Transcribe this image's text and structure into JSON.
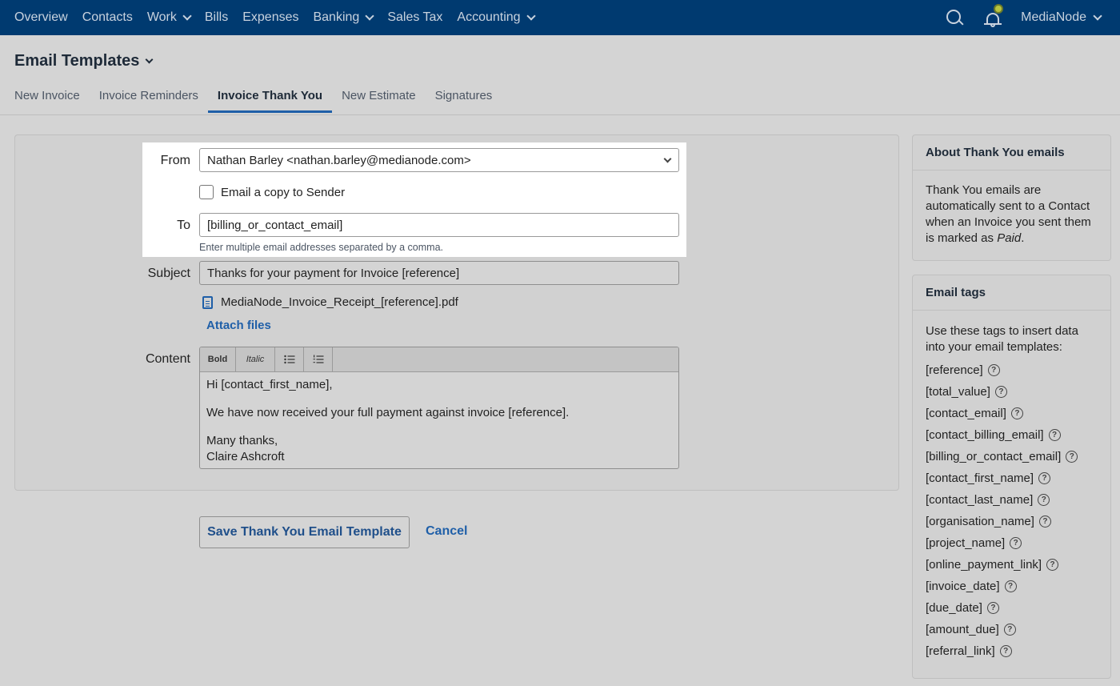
{
  "nav": {
    "items": [
      {
        "label": "Overview",
        "dropdown": false
      },
      {
        "label": "Contacts",
        "dropdown": false
      },
      {
        "label": "Work",
        "dropdown": true
      },
      {
        "label": "Bills",
        "dropdown": false
      },
      {
        "label": "Expenses",
        "dropdown": false
      },
      {
        "label": "Banking",
        "dropdown": true
      },
      {
        "label": "Sales Tax",
        "dropdown": false
      },
      {
        "label": "Accounting",
        "dropdown": true
      }
    ],
    "account": "MediaNode"
  },
  "page": {
    "title": "Email Templates",
    "tabs": [
      "New Invoice",
      "Invoice Reminders",
      "Invoice Thank You",
      "New Estimate",
      "Signatures"
    ],
    "active_tab": "Invoice Thank You"
  },
  "form": {
    "from_label": "From",
    "from_value": "Nathan Barley <nathan.barley@medianode.com>",
    "copy_label": "Email a copy to Sender",
    "to_label": "To",
    "to_value": "[billing_or_contact_email]",
    "to_hint": "Enter multiple email addresses separated by a comma.",
    "subject_label": "Subject",
    "subject_value": "Thanks for your payment for Invoice [reference]",
    "attachment": "MediaNode_Invoice_Receipt_[reference].pdf",
    "attach_files": "Attach files",
    "content_label": "Content",
    "toolbar": {
      "bold": "Bold",
      "italic": "Italic"
    },
    "content": {
      "line1": "Hi [contact_first_name],",
      "line2": "We have now received your full payment against invoice [reference].",
      "line3": "Many thanks,",
      "line4": "Claire Ashcroft"
    },
    "save_label": "Save Thank You Email Template",
    "cancel_label": "Cancel"
  },
  "about": {
    "title": "About Thank You emails",
    "text": "Thank You emails are automatically sent to a Contact when an Invoice you sent them is marked as ",
    "emphasis": "Paid",
    "end": "."
  },
  "tags": {
    "title": "Email tags",
    "intro": "Use these tags to insert data into your email templates:",
    "items": [
      "[reference]",
      "[total_value]",
      "[contact_email]",
      "[contact_billing_email]",
      "[billing_or_contact_email]",
      "[contact_first_name]",
      "[contact_last_name]",
      "[organisation_name]",
      "[project_name]",
      "[online_payment_link]",
      "[invoice_date]",
      "[due_date]",
      "[amount_due]",
      "[referral_link]"
    ]
  },
  "colors": {
    "nav_bg": "#003a70",
    "link": "#1f5fa8",
    "notification_dot": "#b7c43f"
  },
  "icons": {
    "search": "search-icon",
    "notifications": "bell-icon",
    "attachment": "document-icon",
    "help": "question-circle-icon"
  }
}
